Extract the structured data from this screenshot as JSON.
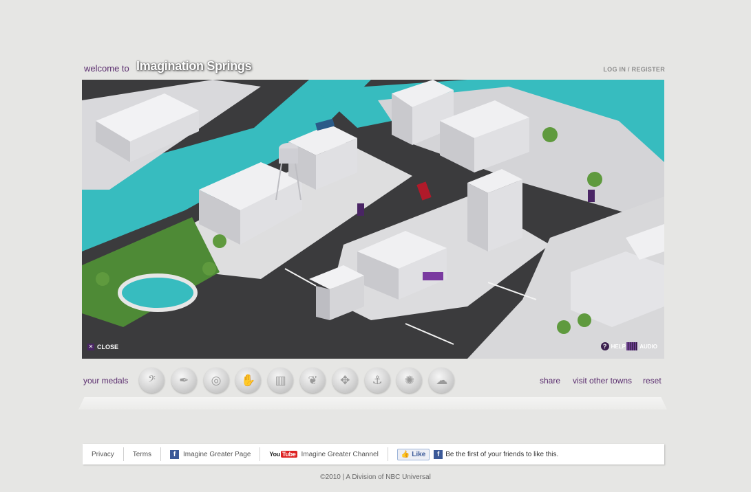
{
  "header": {
    "welcome": "welcome to",
    "town_name": "Imagination Springs",
    "login": "LOG IN",
    "separator": "/",
    "register": "REGISTER"
  },
  "map": {
    "close_label": "CLOSE",
    "help_label": "HELP",
    "audio_label": "AUDIO",
    "close_icon": "close-icon",
    "help_icon": "question-icon",
    "audio_icon": "audio-bars-icon",
    "colors": {
      "road": "#3b3b3d",
      "water": "#37bcbf",
      "grass": "#4e8a36",
      "building": "#ecebef",
      "accent": "#4a2565"
    }
  },
  "medals": {
    "label": "your medals",
    "items": [
      {
        "icon": "bass-clef-icon",
        "glyph": "𝄢"
      },
      {
        "icon": "pen-nib-icon",
        "glyph": "✒"
      },
      {
        "icon": "swirl-icon",
        "glyph": "◎"
      },
      {
        "icon": "hand-icon",
        "glyph": "✋"
      },
      {
        "icon": "city-skyline-icon",
        "glyph": "▥"
      },
      {
        "icon": "butterfly-icon",
        "glyph": "❦"
      },
      {
        "icon": "maple-leaf-icon",
        "glyph": "✥"
      },
      {
        "icon": "anchor-icon",
        "glyph": "⚓"
      },
      {
        "icon": "sunburst-icon",
        "glyph": "✺"
      },
      {
        "icon": "tree-icon",
        "glyph": "☁"
      }
    ]
  },
  "nav": {
    "share": "share",
    "visit_other_towns": "visit other towns",
    "reset": "reset"
  },
  "footer": {
    "privacy": "Privacy",
    "terms": "Terms",
    "facebook_page": "Imagine Greater Page",
    "youtube_channel": "Imagine Greater Channel",
    "youtube_logo": "You",
    "youtube_logo_tube": "Tube",
    "fb_letter": "f",
    "like_label": "Like",
    "like_text": "Be the first of your friends to like this."
  },
  "copyright": "©2010 | A Division of NBC Universal"
}
